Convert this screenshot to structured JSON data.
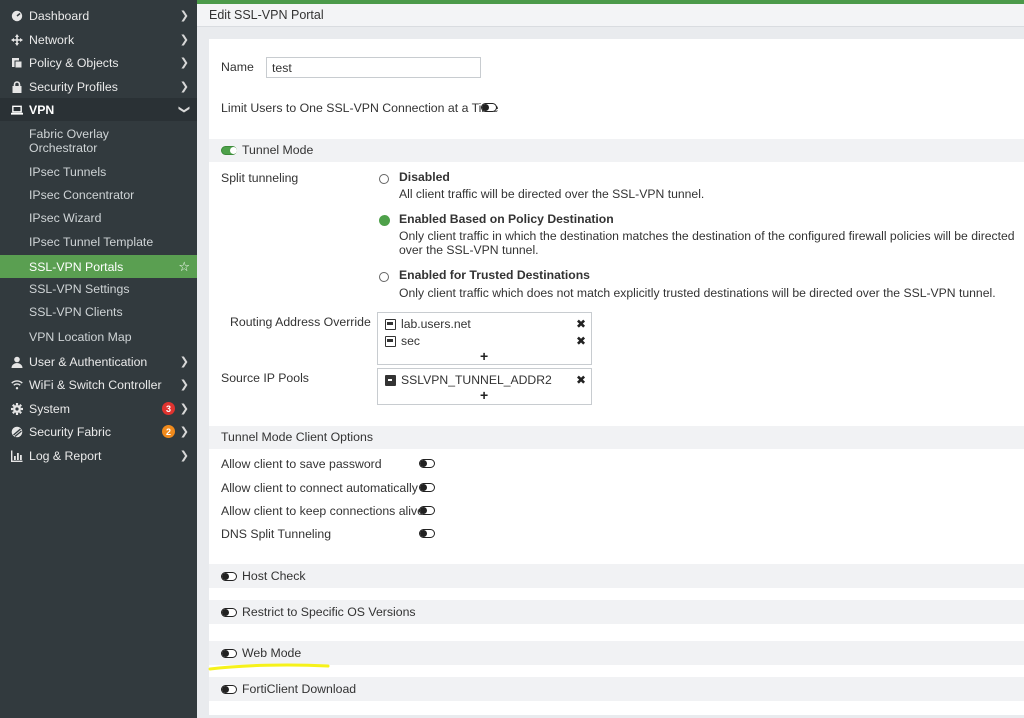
{
  "sidebar": {
    "items": [
      {
        "label": "Dashboard",
        "icon": "dashboard-icon"
      },
      {
        "label": "Network",
        "icon": "network-icon"
      },
      {
        "label": "Policy & Objects",
        "icon": "policy-icon"
      },
      {
        "label": "Security Profiles",
        "icon": "lock-icon"
      },
      {
        "label": "VPN",
        "icon": "laptop-icon"
      },
      {
        "label": "User & Authentication",
        "icon": "user-icon"
      },
      {
        "label": "WiFi & Switch Controller",
        "icon": "wifi-icon"
      },
      {
        "label": "System",
        "icon": "gear-icon",
        "badge": "3"
      },
      {
        "label": "Security Fabric",
        "icon": "fabric-icon",
        "badge": "2"
      },
      {
        "label": "Log & Report",
        "icon": "chart-icon"
      }
    ],
    "vpn_sub": [
      "Fabric Overlay\nOrchestrator",
      "IPsec Tunnels",
      "IPsec Concentrator",
      "IPsec Wizard",
      "IPsec Tunnel Template",
      "SSL-VPN Portals",
      "SSL-VPN Settings",
      "SSL-VPN Clients",
      "VPN Location Map"
    ],
    "badge_colors": {
      "system": "#e0332f",
      "fabric": "#f08a1c"
    },
    "active_color": "#5a9f51"
  },
  "header": {
    "title": "Edit SSL-VPN Portal"
  },
  "form": {
    "name_label": "Name",
    "name_value": "test",
    "limit_label": "Limit Users to One SSL-VPN Connection at a Time",
    "tunnel_mode_label": "Tunnel Mode",
    "split_label": "Split tunneling",
    "split_options": [
      {
        "title": "Disabled",
        "desc": "All client traffic will be directed over the SSL-VPN tunnel.",
        "checked": false
      },
      {
        "title": "Enabled Based on Policy Destination",
        "desc": "Only client traffic in which the destination matches the destination of the configured firewall policies will be directed over the SSL-VPN tunnel.",
        "checked": true
      },
      {
        "title": "Enabled for Trusted Destinations",
        "desc": "Only client traffic which does not match explicitly trusted destinations will be directed over the SSL-VPN tunnel.",
        "checked": false
      }
    ],
    "routing_label": "Routing Address Override",
    "routing_entries": [
      "lab.users.net",
      "sec"
    ],
    "pools_label": "Source IP Pools",
    "pool_entries": [
      "SSLVPN_TUNNEL_ADDR2"
    ],
    "add_symbol": "+",
    "remove_symbol": "✖",
    "client_options_title": "Tunnel Mode Client Options",
    "client_options": [
      "Allow client to save password",
      "Allow client to connect automatically",
      "Allow client to keep connections alive",
      "DNS Split Tunneling"
    ],
    "sections": [
      "Host Check",
      "Restrict to Specific OS Versions",
      "Web Mode",
      "FortiClient Download"
    ]
  },
  "colors": {
    "accent": "#4ea14a",
    "sidebar_bg": "#323a3e",
    "highlight": "#f6f21a"
  }
}
